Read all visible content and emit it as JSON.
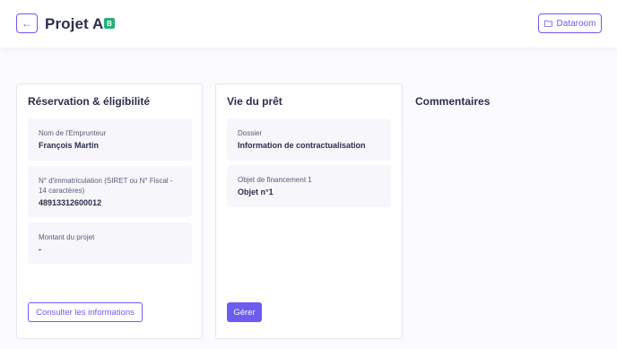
{
  "header": {
    "back_icon": "arrow-left-icon",
    "title": "Projet A",
    "badge": "B",
    "badge_color": "#27ae78",
    "dataroom_icon": "folder-icon",
    "dataroom_label": "Dataroom"
  },
  "accent_color": "#6d5cf0",
  "reservation": {
    "title": "Réservation & éligibilité",
    "fields": [
      {
        "label": "Nom de l'Emprunteur",
        "value": "François Martin"
      },
      {
        "label": "N° d'immatriculation (SIRET ou N° Fiscal - 14 caractères)",
        "value": "48913312600012"
      },
      {
        "label": "Montant du projet",
        "value": "-"
      }
    ],
    "button_label": "Consulter les informations"
  },
  "loan": {
    "title": "Vie du prêt",
    "fields": [
      {
        "label": "Dossier",
        "value": "Information de contractualisation"
      },
      {
        "label": "Objet de financement 1",
        "value": "Objet n°1"
      }
    ],
    "button_label": "Gérer"
  },
  "comments": {
    "title": "Commentaires"
  }
}
